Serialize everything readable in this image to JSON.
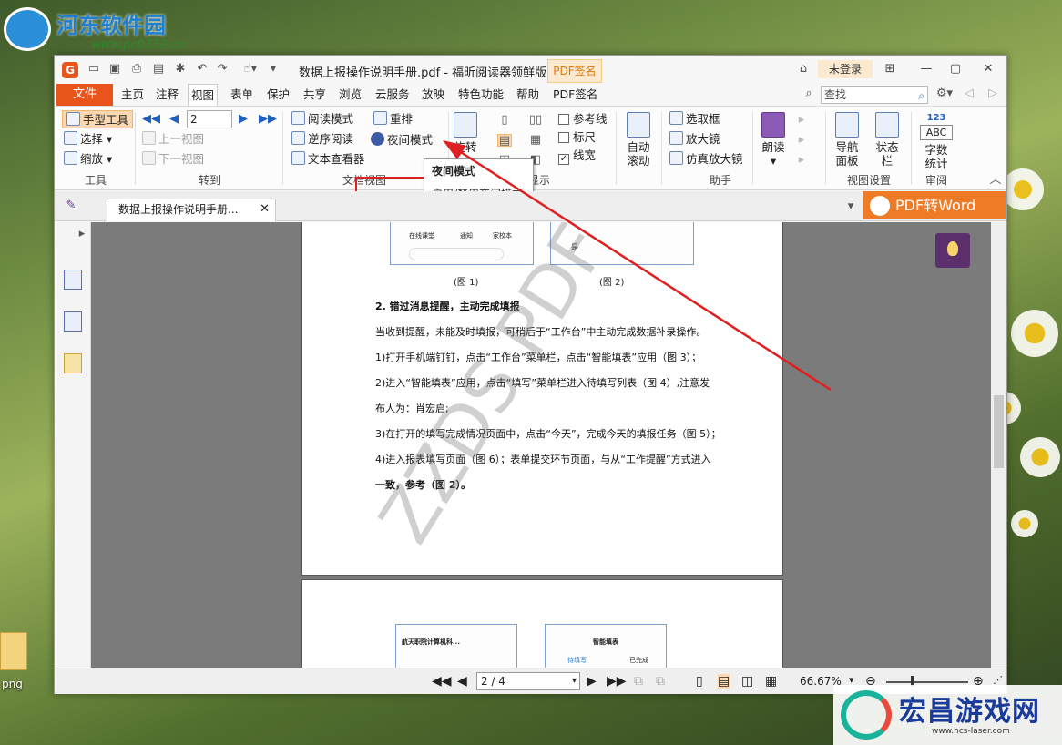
{
  "desktop": {
    "site_logo_name": "河东软件园",
    "site_logo_url": "www.pc0359.cn",
    "icon_label": "png",
    "corner_logo_name": "宏昌游戏网",
    "corner_logo_url": "www.hcs-laser.com"
  },
  "window": {
    "title": "数据上报操作说明手册.pdf - 福昕阅读器领鲜版",
    "pdf_sign_top": "PDF签名",
    "login": "未登录"
  },
  "menu": {
    "file": "文件",
    "items": [
      "主页",
      "注释",
      "视图",
      "表单",
      "保护",
      "共享",
      "浏览",
      "云服务",
      "放映",
      "特色功能",
      "帮助",
      "PDF签名"
    ],
    "search_placeholder": "查找"
  },
  "ribbon": {
    "tools": {
      "hand": "手型工具",
      "select": "选择",
      "zoom": "缩放",
      "label": "工具"
    },
    "goto": {
      "page_value": "2",
      "prev_view": "上一视图",
      "next_view": "下一视图",
      "label": "转到"
    },
    "docview": {
      "reading": "阅读模式",
      "reverse": "逆序阅读",
      "text_viewer": "文本查看器",
      "reflow": "重排",
      "night": "夜间模式",
      "label": "文档视图"
    },
    "rotate": "旋转",
    "display": {
      "guides": "参考线",
      "ruler": "标尺",
      "lineweight": "线宽",
      "label": "显示"
    },
    "auto_scroll": [
      "自动",
      "滚动"
    ],
    "assistant": {
      "select_box": "选取框",
      "magnifier": "放大镜",
      "loupe": "仿真放大镜",
      "label": "助手"
    },
    "read_aloud": "朗读",
    "viewset": {
      "nav": [
        "导航",
        "面板"
      ],
      "status": [
        "状态",
        "栏"
      ],
      "label": "视图设置"
    },
    "review": {
      "abc_top": "123",
      "abc": "ABC",
      "wordcount": [
        "字数",
        "统计"
      ],
      "label": "审阅"
    }
  },
  "tooltip": {
    "title": "夜间模式",
    "desc": "启用/禁用夜间模式"
  },
  "doc_tab": {
    "name": "数据上报操作说明手册...."
  },
  "pdf_to_word": "PDF转Word",
  "document": {
    "fig1": "(图 1)",
    "fig2": "(图 2)",
    "phone1_items": [
      "在线课堂",
      "通知",
      "家校本"
    ],
    "phone2_text": "是",
    "heading": "2. 错过消息提醒，主动完成填报",
    "lines": [
      "当收到提醒，未能及时填报，可稍后于“工作台”中主动完成数据补录操作。",
      "1)打开手机端钉钉，点击“工作台”菜单栏，点击“智能填表”应用（图 3）；",
      "2)进入“智能填表”应用，点击“填写”菜单栏进入待填写列表（图 4）,注意发",
      "布人为：肖宏启;",
      "3)在打开的填写完成情况页面中，点击“今天”，完成今天的填报任务（图 5）；",
      "4)进入报表填写页面（图 6）；表单提交环节页面，与从“工作提醒”方式进入",
      "一致，参考（图 2）。"
    ],
    "watermark": "ZZDS PDF",
    "page2_phone1_title": "航天职院计算机科...",
    "page2_phone2_title": "智能填表",
    "page2_phone2_tab_a": "待填写",
    "page2_phone2_tab_b": "已完成"
  },
  "statusbar": {
    "page": "2 / 4",
    "zoom": "66.67%"
  }
}
